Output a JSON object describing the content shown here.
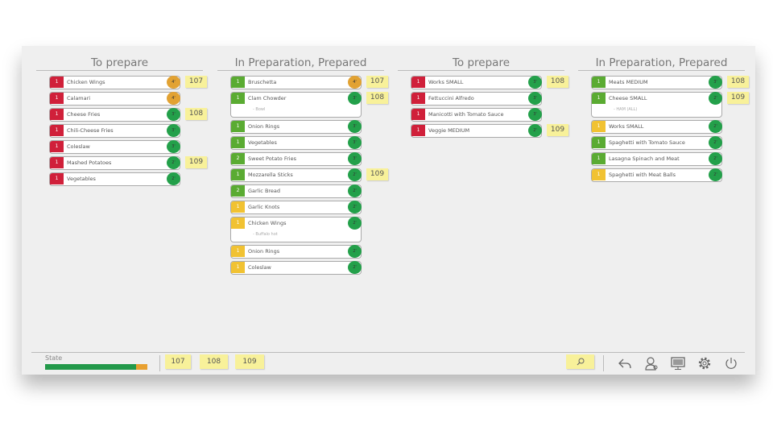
{
  "colors": {
    "red": "#d0203a",
    "green": "#5aab32",
    "yellow": "#f1c232",
    "timer_orange": "#e2a232",
    "timer_green": "#23a04a",
    "state_green": "#23994a",
    "state_orange": "#e8a030"
  },
  "columns": [
    {
      "title": "To prepare",
      "items": [
        {
          "qty": "1",
          "name": "Chicken Wings",
          "status": "red",
          "timer": "4'",
          "timer_color": "orange",
          "tag": "107"
        },
        {
          "qty": "1",
          "name": "Calamari",
          "status": "red",
          "timer": "4'",
          "timer_color": "orange"
        },
        {
          "qty": "1",
          "name": "Cheese Fries",
          "status": "red",
          "timer": "3'",
          "timer_color": "green",
          "tag": "108"
        },
        {
          "qty": "1",
          "name": "Chili-Cheese Fries",
          "status": "red",
          "timer": "3'",
          "timer_color": "green"
        },
        {
          "qty": "1",
          "name": "Coleslaw",
          "status": "red",
          "timer": "3'",
          "timer_color": "green"
        },
        {
          "qty": "1",
          "name": "Mashed Potatoes",
          "status": "red",
          "timer": "2'",
          "timer_color": "green",
          "tag": "109"
        },
        {
          "qty": "1",
          "name": "Vegetables",
          "status": "red",
          "timer": "2'",
          "timer_color": "green"
        }
      ]
    },
    {
      "title": "In Preparation, Prepared",
      "items": [
        {
          "qty": "1",
          "name": "Bruschetta",
          "status": "green",
          "timer": "4'",
          "timer_color": "orange",
          "tag": "107"
        },
        {
          "qty": "1",
          "name": "Clam Chowder",
          "modifier": "- Bowl",
          "status": "green",
          "timer": "3'",
          "timer_color": "green",
          "tag": "108"
        },
        {
          "qty": "1",
          "name": "Onion Rings",
          "status": "green",
          "timer": "3'",
          "timer_color": "green"
        },
        {
          "qty": "1",
          "name": "Vegetables",
          "status": "green",
          "timer": "3'",
          "timer_color": "green"
        },
        {
          "qty": "2",
          "name": "Sweet Potato Fries",
          "status": "green",
          "timer": "3'",
          "timer_color": "green"
        },
        {
          "qty": "1",
          "name": "Mozzarella Sticks",
          "status": "green",
          "timer": "2'",
          "timer_color": "green",
          "tag": "109"
        },
        {
          "qty": "2",
          "name": "Garlic Bread",
          "status": "green",
          "timer": "2'",
          "timer_color": "green"
        },
        {
          "qty": "1",
          "name": "Garlic Knots",
          "status": "yellow",
          "timer": "2'",
          "timer_color": "green"
        },
        {
          "qty": "1",
          "name": "Chicken Wings",
          "modifier": "- Buffalo hot",
          "status": "yellow",
          "timer": "2'",
          "timer_color": "green"
        },
        {
          "qty": "1",
          "name": "Onion Rings",
          "status": "yellow",
          "timer": "2'",
          "timer_color": "green"
        },
        {
          "qty": "1",
          "name": "Coleslaw",
          "status": "yellow",
          "timer": "2'",
          "timer_color": "green"
        }
      ]
    },
    {
      "title": "To prepare",
      "items": [
        {
          "qty": "1",
          "name": "Works SMALL",
          "status": "red",
          "timer": "3'",
          "timer_color": "green",
          "tag": "108"
        },
        {
          "qty": "1",
          "name": "Fettuccini Alfredo",
          "status": "red",
          "timer": "3'",
          "timer_color": "green"
        },
        {
          "qty": "1",
          "name": "Manicotti with Tomato Sauce",
          "status": "red",
          "timer": "3'",
          "timer_color": "green"
        },
        {
          "qty": "1",
          "name": "Veggie MEDIUM",
          "status": "red",
          "timer": "2'",
          "timer_color": "green",
          "tag": "109"
        }
      ]
    },
    {
      "title": "In Preparation, Prepared",
      "items": [
        {
          "qty": "1",
          "name": "Meats MEDIUM",
          "status": "green",
          "timer": "3'",
          "timer_color": "green",
          "tag": "108"
        },
        {
          "qty": "1",
          "name": "Cheese SMALL",
          "modifier": "- HAM (ALL)",
          "status": "green",
          "timer": "2'",
          "timer_color": "green",
          "tag": "109"
        },
        {
          "qty": "1",
          "name": "Works SMALL",
          "status": "yellow",
          "timer": "2'",
          "timer_color": "green"
        },
        {
          "qty": "1",
          "name": "Spaghetti  with Tomato Sauce",
          "status": "green",
          "timer": "2'",
          "timer_color": "green"
        },
        {
          "qty": "1",
          "name": "Lasagna Spinach and Meat",
          "status": "green",
          "timer": "2'",
          "timer_color": "green"
        },
        {
          "qty": "1",
          "name": "Spaghetti with Meat Balls",
          "status": "yellow",
          "timer": "2'",
          "timer_color": "green"
        }
      ]
    }
  ],
  "footer": {
    "state_label": "State",
    "state_progress_percent": 89,
    "order_tags": [
      "107",
      "108",
      "109"
    ],
    "icons": [
      "search-icon",
      "undo-icon",
      "user-icon",
      "monitor-icon",
      "gear-icon",
      "power-icon"
    ]
  }
}
